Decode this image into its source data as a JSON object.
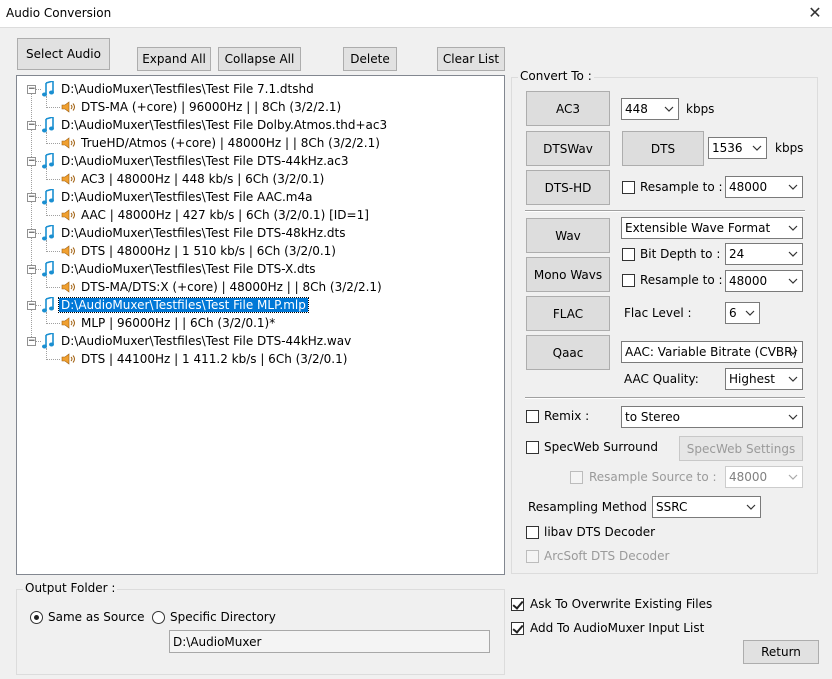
{
  "window": {
    "title": "Audio Conversion",
    "close_glyph": "✕"
  },
  "toolbar": {
    "select_audio": "Select Audio",
    "expand_all": "Expand All",
    "collapse_all": "Collapse All",
    "delete": "Delete",
    "clear_list": "Clear List"
  },
  "files": [
    {
      "path": "D:\\AudioMuxer\\Testfiles\\Test File 7.1.dtshd",
      "info": "DTS-MA (+core) | 96000Hz |  | 8Ch (3/2/2.1)"
    },
    {
      "path": "D:\\AudioMuxer\\Testfiles\\Test File Dolby.Atmos.thd+ac3",
      "info": "TrueHD/Atmos (+core) | 48000Hz |  | 8Ch (3/2/2.1)"
    },
    {
      "path": "D:\\AudioMuxer\\Testfiles\\Test File DTS-44kHz.ac3",
      "info": "AC3 | 48000Hz | 448 kb/s | 6Ch (3/2/0.1)"
    },
    {
      "path": "D:\\AudioMuxer\\Testfiles\\Test File AAC.m4a",
      "info": "AAC | 48000Hz | 427 kb/s | 6Ch (3/2/0.1) [ID=1]"
    },
    {
      "path": "D:\\AudioMuxer\\Testfiles\\Test File DTS-48kHz.dts",
      "info": "DTS | 48000Hz | 1 510 kb/s | 6Ch (3/2/0.1)"
    },
    {
      "path": "D:\\AudioMuxer\\Testfiles\\Test File DTS-X.dts",
      "info": "DTS-MA/DTS:X (+core) | 48000Hz |  | 8Ch (3/2/2.1)"
    },
    {
      "path": "D:\\AudioMuxer\\Testfiles\\Test File MLP.mlp",
      "info": "MLP | 96000Hz |  | 6Ch (3/2/0.1)*",
      "selected": true
    },
    {
      "path": "D:\\AudioMuxer\\Testfiles\\Test File DTS-44kHz.wav",
      "info": "DTS | 44100Hz | 1 411.2 kb/s | 6Ch (3/2/0.1)"
    }
  ],
  "convert": {
    "group_label": "Convert To :",
    "ac3": {
      "button": "AC3",
      "bitrate": "448",
      "unit": "kbps"
    },
    "dtswav": {
      "button": "DTSWav"
    },
    "dts": {
      "button": "DTS",
      "bitrate": "1536",
      "unit": "kbps"
    },
    "dtshd": {
      "button": "DTS-HD",
      "resample_label": "Resample to :",
      "resample_value": "48000",
      "resample_checked": false
    },
    "wav": {
      "button": "Wav",
      "format": "Extensible Wave Format"
    },
    "monowavs": {
      "button": "Mono Wavs",
      "bitdepth_label": "Bit Depth to :",
      "bitdepth_value": "24",
      "bitdepth_checked": false,
      "resample_label": "Resample to :",
      "resample_value": "48000",
      "resample_checked": false
    },
    "flac": {
      "button": "FLAC",
      "level_label": "Flac Level :",
      "level_value": "6"
    },
    "qaac": {
      "button": "Qaac",
      "mode": "AAC: Variable Bitrate (CVBR)",
      "quality_label": "AAC Quality:",
      "quality_value": "Highest"
    },
    "remix": {
      "label": "Remix :",
      "value": "to Stereo",
      "checked": false
    },
    "specweb": {
      "label": "SpecWeb Surround",
      "settings_button": "SpecWeb Settings",
      "checked": false,
      "resample_source_label": "Resample Source to :",
      "resample_source_value": "48000"
    },
    "resampling": {
      "label": "Resampling Method :",
      "value": "SSRC"
    },
    "libav": {
      "label": "libav DTS Decoder",
      "checked": false
    },
    "arcsoft": {
      "label": "ArcSoft DTS Decoder",
      "checked": false
    }
  },
  "output": {
    "group_label": "Output Folder :",
    "same_as_source": "Same as Source",
    "specific_directory": "Specific Directory",
    "selected": "same_as_source",
    "directory": "D:\\AudioMuxer"
  },
  "options": {
    "ask_overwrite": {
      "label": "Ask To Overwrite Existing Files",
      "checked": true
    },
    "add_to_input": {
      "label": "Add To AudioMuxer Input List",
      "checked": true
    }
  },
  "footer": {
    "return": "Return"
  },
  "colors": {
    "selection": "#0078d7",
    "note_icon": "#1a8fd1",
    "speaker_icon": "#f0a030"
  }
}
